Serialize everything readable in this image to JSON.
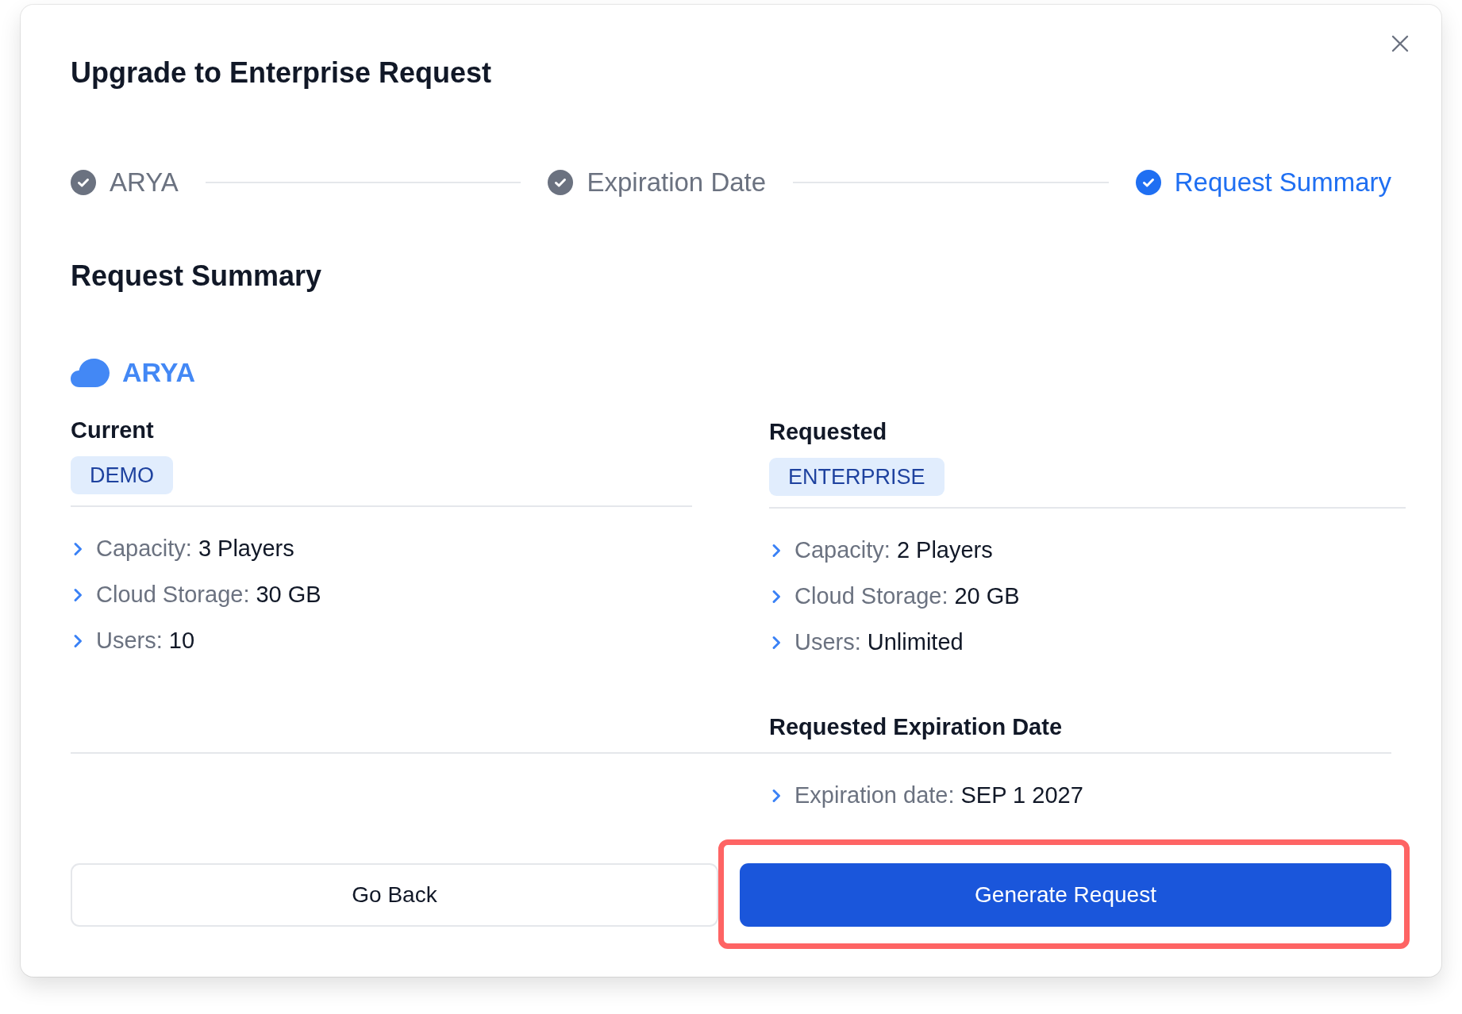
{
  "dialog": {
    "title": "Upgrade to Enterprise Request"
  },
  "steps": [
    {
      "label": "ARYA",
      "completed": true,
      "selected": false
    },
    {
      "label": "Expiration Date",
      "completed": true,
      "selected": false
    },
    {
      "label": "Request Summary",
      "completed": true,
      "selected": true
    }
  ],
  "section_title": "Request Summary",
  "product": {
    "name": "ARYA"
  },
  "plans": [
    {
      "heading": "Current",
      "tier": "DEMO",
      "features": [
        {
          "label": "Capacity:",
          "value": "3 Players"
        },
        {
          "label": "Cloud Storage:",
          "value": "30 GB"
        },
        {
          "label": "Users:",
          "value": "10"
        }
      ]
    },
    {
      "heading": "Requested",
      "tier": "ENTERPRISE",
      "features": [
        {
          "label": "Capacity:",
          "value": "2 Players"
        },
        {
          "label": "Cloud Storage:",
          "value": "20 GB"
        },
        {
          "label": "Users:",
          "value": "Unlimited"
        }
      ]
    }
  ],
  "expiration": {
    "heading": "Requested Expiration Date",
    "features": [
      {
        "label": "Expiration date:",
        "value": "SEP 1 2027"
      }
    ]
  },
  "actions": [
    {
      "label": "Go Back",
      "kind": "secondary",
      "highlighted": false
    },
    {
      "label": "Generate Request",
      "kind": "primary",
      "highlighted": true
    }
  ]
}
